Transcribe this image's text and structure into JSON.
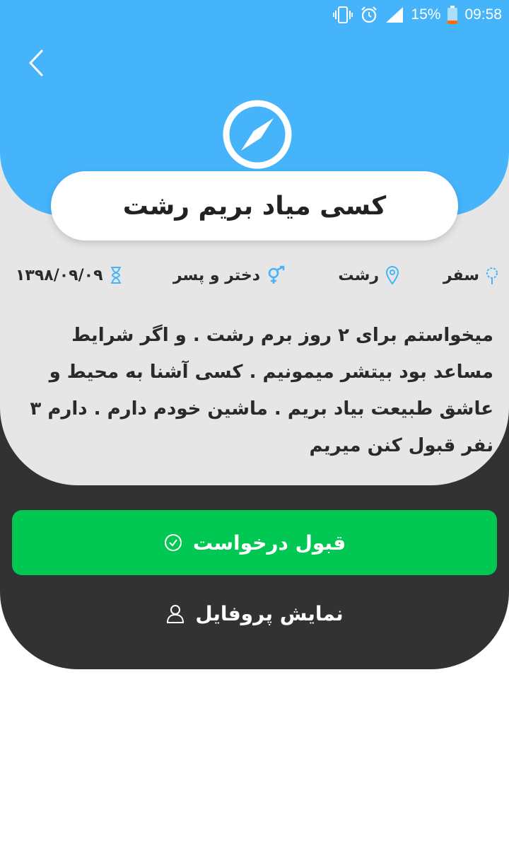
{
  "status_bar": {
    "battery_percent": "15%",
    "time": "09:58",
    "icons": [
      "vibrate-icon",
      "alarm-icon",
      "signal-icon",
      "battery-icon"
    ]
  },
  "header": {
    "back_icon": "chevron-left-icon",
    "category_icon": "compass-icon",
    "accent_color": "#46b4fa"
  },
  "post": {
    "title": "کسی میاد بریم رشت",
    "category": "سفر",
    "city": "رشت",
    "gender": "دختر و پسر",
    "date": "۱۳۹۸/۰۹/۰۹",
    "description": "میخواستم برای ۲ روز برم رشت . و اگر شرایط مساعد بود بیتشر میمونیم . کسی آشنا به محیط و عاشق طبیعت بیاد بریم . ماشین خودم دارم . دارم ۳ نفر قبول کنن میریم"
  },
  "actions": {
    "accept_label": "قبول درخواست",
    "accept_color": "#00c853",
    "profile_label": "نمایش پروفایل"
  }
}
